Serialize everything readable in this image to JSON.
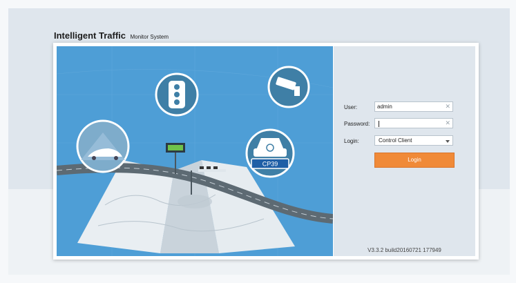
{
  "header": {
    "title_main": "Intelligent Traffic",
    "title_sub": "Monitor System"
  },
  "illustration": {
    "plate_text": "CP39",
    "icons": [
      "traffic-light-icon",
      "surveillance-camera-icon",
      "car-icon",
      "license-plate-icon",
      "highway-car-icon",
      "led-sign-icon",
      "map-icon"
    ]
  },
  "login": {
    "user_label": "User:",
    "user_value": "admin",
    "password_label": "Password:",
    "password_value": "",
    "login_type_label": "Login:",
    "login_type_value": "Control Client",
    "login_button": "Login",
    "clear_glyph": "✕"
  },
  "footer": {
    "version": "V3.3.2 build20160721 177949"
  },
  "colors": {
    "sky_blue": "#4e9ed6",
    "panel_bg": "#dfe6ed",
    "accent_orange": "#f08a38"
  }
}
